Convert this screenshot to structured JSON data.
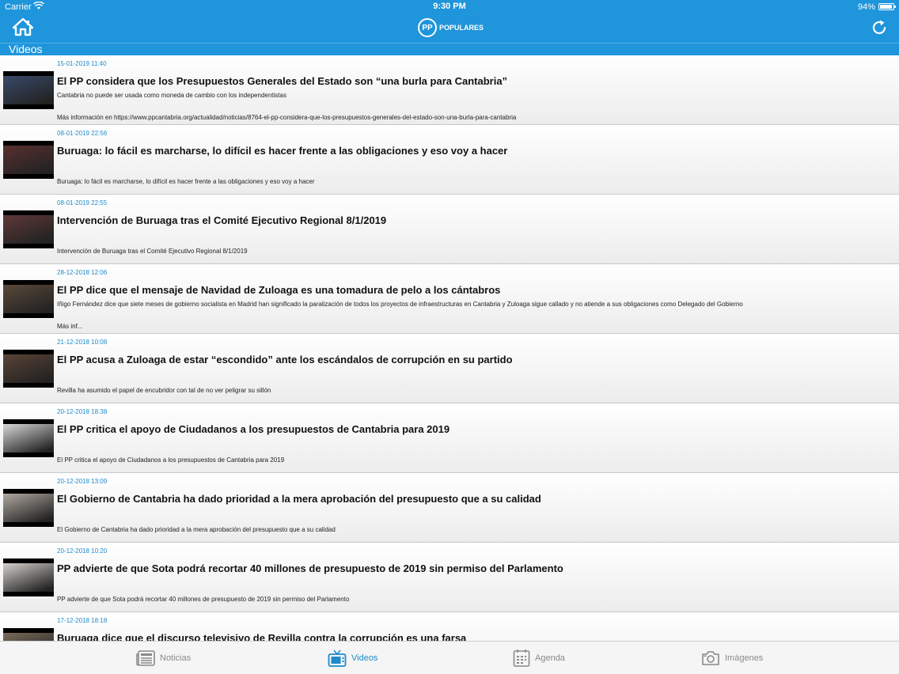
{
  "status_bar": {
    "carrier": "Carrier",
    "time": "9:30 PM",
    "battery": "94%"
  },
  "header": {
    "logo_text": "POPULARES",
    "logo_initials": "PP"
  },
  "section": {
    "title": "Videos"
  },
  "videos": [
    {
      "date": "15-01-2019 11:40",
      "title": "El PP considera que los Presupuestos Generales del Estado son “una burla para Cantabria”",
      "summary": "Cantabria no puede ser usada como moneda de cambio con los independentistas",
      "link": "Más información en https://www.ppcantabria.org/actualidad/noticias/8764-el-pp-considera-que-los-presupuestos-generales-del-estado-son-una-burla-para-cantabria"
    },
    {
      "date": "08-01-2019 22:56",
      "title": "Buruaga: lo fácil es marcharse, lo difícil es hacer frente a las obligaciones y eso voy a hacer",
      "summary": "Buruaga: lo fácil es marcharse, lo difícil es hacer frente a las obligaciones y eso voy a hacer"
    },
    {
      "date": "08-01-2019 22:55",
      "title": "Intervención de Buruaga tras el Comité Ejecutivo Regional 8/1/2019",
      "summary": "Intervención de Buruaga tras el Comité Ejecutivo Regional 8/1/2019"
    },
    {
      "date": "28-12-2018 12:06",
      "title": "El PP dice que el mensaje de Navidad de Zuloaga es una tomadura de pelo a los cántabros",
      "summary": "Iñigo Fernández dice que siete meses de gobierno socialista en Madrid han significado la paralización de todos los proyectos de infraestructuras en Cantabria y Zuloaga sigue callado y no atiende a sus obligaciones como Delegado del Gobierno",
      "link": "Más inf..."
    },
    {
      "date": "21-12-2018 10:08",
      "title": "El PP acusa a Zuloaga de estar “escondido” ante los escándalos de corrupción en su partido",
      "summary": "Revilla ha asumido el papel de encubridor con tal de no ver peligrar su sillón"
    },
    {
      "date": "20-12-2018 18:38",
      "title": "El PP critica el apoyo de Ciudadanos a los presupuestos de Cantabria para 2019",
      "summary": "El PP critica el apoyo de Ciudadanos a los presupuestos de Cantabria para 2019"
    },
    {
      "date": "20-12-2018 13:09",
      "title": "El Gobierno de Cantabria ha dado prioridad a la mera aprobación del presupuesto que a su calidad",
      "summary": "El Gobierno de Cantabria ha dado prioridad a la mera aprobación del presupuesto que a su calidad"
    },
    {
      "date": "20-12-2018 10:20",
      "title": "PP advierte de que Sota podrá recortar 40 millones de presupuesto de 2019 sin permiso del Parlamento",
      "summary": "PP advierte de que Sota podrá recortar 40 millones de presupuesto de 2019 sin permiso del Parlamento"
    },
    {
      "date": "17-12-2018 18:18",
      "title": "Buruaga dice que el discurso televisivo de Revilla contra la corrupción es una farsa",
      "summary": ""
    }
  ],
  "tabs": [
    {
      "label": "Noticias",
      "icon": "newspaper-icon"
    },
    {
      "label": "Videos",
      "icon": "tv-icon",
      "active": true
    },
    {
      "label": "Agenda",
      "icon": "calendar-icon"
    },
    {
      "label": "Imágenes",
      "icon": "camera-icon"
    }
  ],
  "colors": {
    "brand_blue": "#1f95db",
    "date_blue": "#1e8bcb",
    "tab_inactive": "#8a8a8a"
  }
}
